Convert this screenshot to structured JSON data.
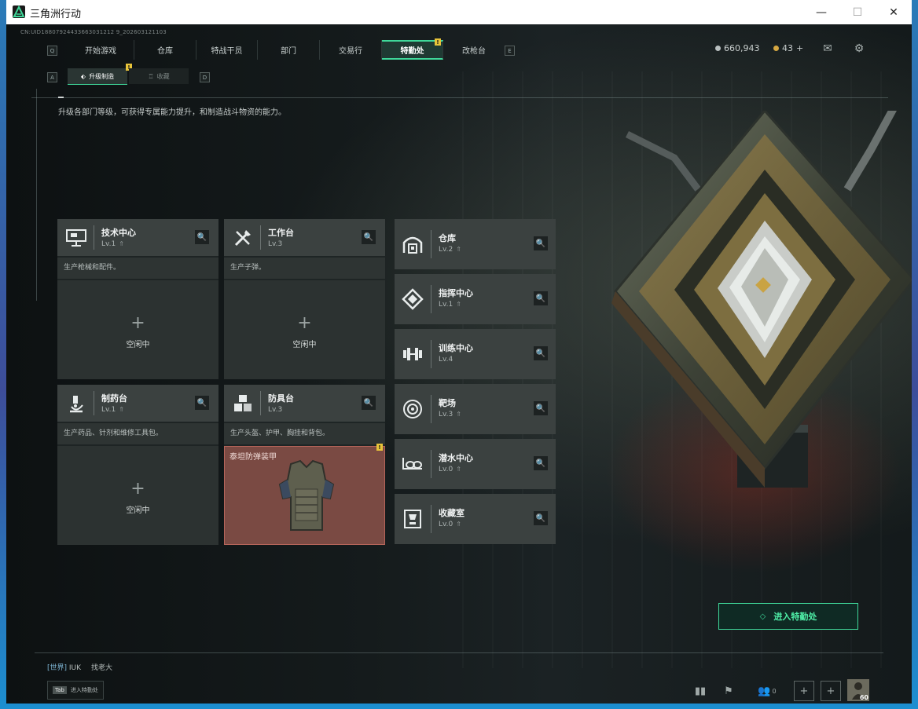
{
  "window": {
    "title": "三角洲行动",
    "controls": {
      "minimize": "—",
      "maximize": "☐",
      "close": "✕"
    }
  },
  "build_info": "CN:UID18807924433663031212 9_202603121103",
  "nav": {
    "left_key": "Q",
    "right_key": "E",
    "tabs": [
      {
        "label": "开始游戏",
        "active": false
      },
      {
        "label": "仓库",
        "active": false
      },
      {
        "label": "特战干员",
        "active": false
      },
      {
        "label": "部门",
        "active": false
      },
      {
        "label": "交易行",
        "active": false
      },
      {
        "label": "特勤处",
        "active": true,
        "badge": "!"
      },
      {
        "label": "改枪台",
        "active": false
      }
    ]
  },
  "currency": {
    "silver": "660,943",
    "gold": "43",
    "add": "+"
  },
  "top_icons": [
    "mail-icon",
    "gear-icon"
  ],
  "subtabs": {
    "left_key": "A",
    "right_key": "D",
    "items": [
      {
        "label": "升级制造",
        "active": true,
        "badge": "!"
      },
      {
        "label": "收藏",
        "active": false
      }
    ]
  },
  "description": "升级各部门等级，可获得专属能力提升，和制造战斗物资的能力。",
  "workshops": [
    {
      "name": "技术中心",
      "level": "Lv.1",
      "desc": "生产枪械和配件。",
      "state": "idle",
      "idle_label": "空闲中",
      "icon": "monitor-icon"
    },
    {
      "name": "工作台",
      "level": "Lv.3",
      "desc": "生产子弹。",
      "state": "idle",
      "idle_label": "空闲中",
      "icon": "tools-icon"
    },
    {
      "name": "制药台",
      "level": "Lv.1",
      "desc": "生产药品、针剂和维修工具包。",
      "state": "idle",
      "idle_label": "空闲中",
      "icon": "microscope-icon"
    },
    {
      "name": "防具台",
      "level": "Lv.3",
      "desc": "生产头盔、护甲、胸挂和背包。",
      "state": "crafting",
      "item": "泰坦防弹装甲",
      "badge": "!",
      "icon": "armor-crates-icon"
    }
  ],
  "facilities": [
    {
      "name": "仓库",
      "level": "Lv.2",
      "icon": "warehouse-icon"
    },
    {
      "name": "指挥中心",
      "level": "Lv.1",
      "icon": "command-icon"
    },
    {
      "name": "训练中心",
      "level": "Lv.4",
      "icon": "dumbbell-icon"
    },
    {
      "name": "靶场",
      "level": "Lv.3",
      "icon": "target-icon"
    },
    {
      "name": "潜水中心",
      "level": "Lv.0",
      "icon": "dive-icon"
    },
    {
      "name": "收藏室",
      "level": "Lv.0",
      "icon": "trophy-icon"
    }
  ],
  "enter_button": "进入特勤处",
  "chat": {
    "channel": "[世界]",
    "user": "IUK",
    "message": "找老大"
  },
  "tab_hint": {
    "key": "Tab",
    "label": "进入特勤处"
  },
  "bottom": {
    "friends_count": "0",
    "avatar_level": "60"
  },
  "colors": {
    "accent": "#3fd89a",
    "badge": "#e8c43a",
    "craft": "#7a4a43"
  }
}
